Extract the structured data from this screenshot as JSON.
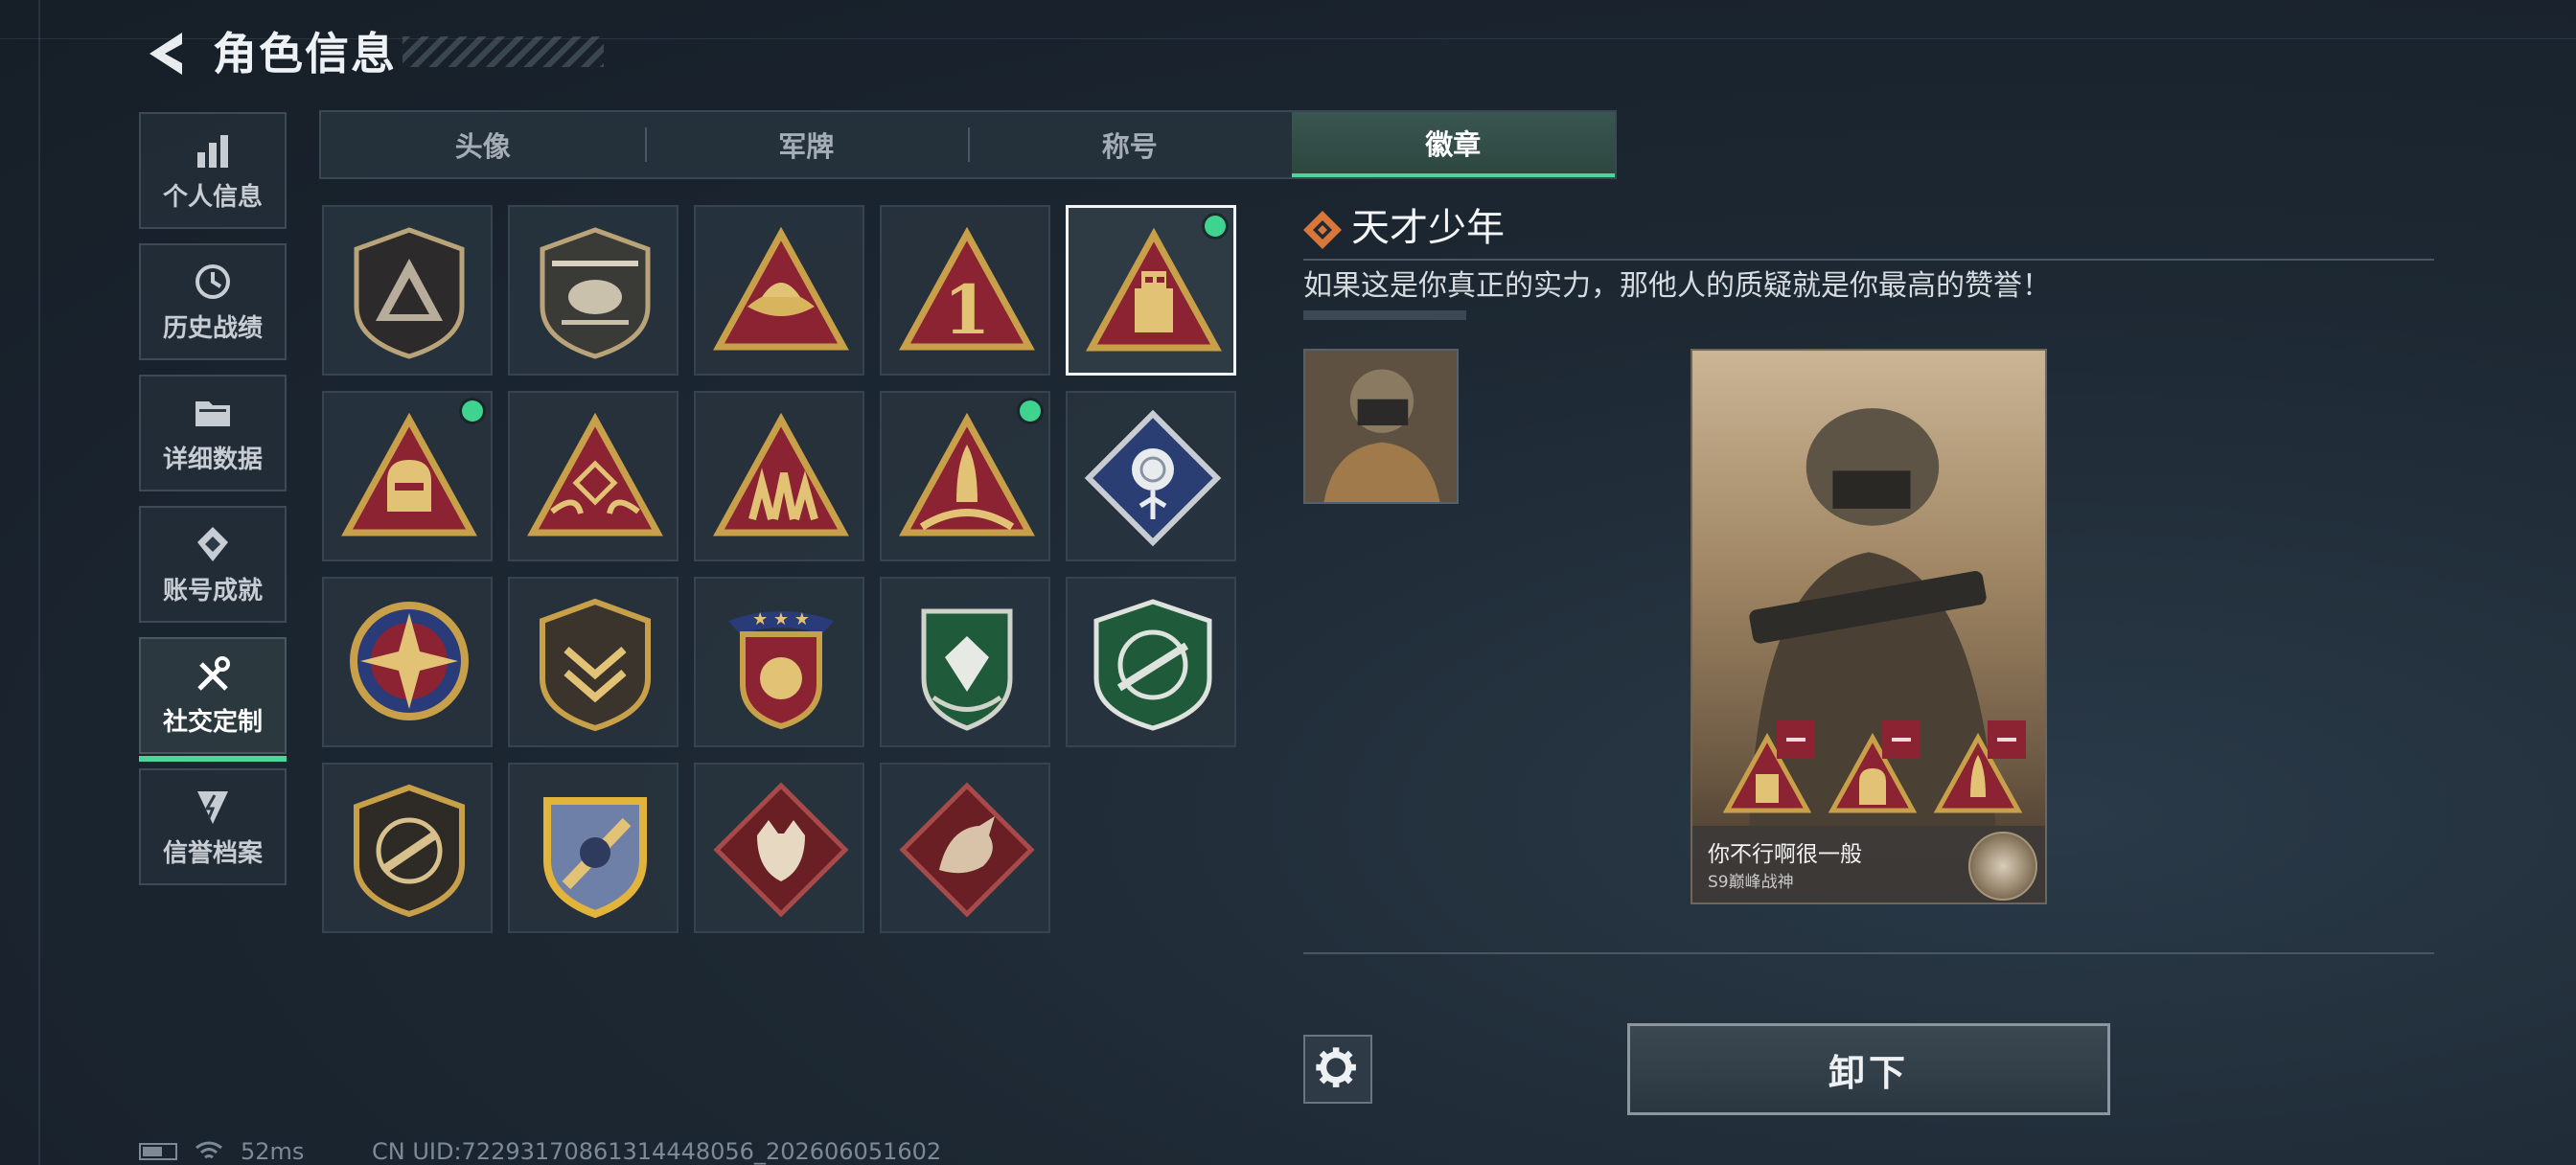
{
  "header": {
    "title": "角色信息"
  },
  "sidebar": {
    "items": [
      {
        "label": "个人信息",
        "icon": "bar-chart-icon"
      },
      {
        "label": "历史战绩",
        "icon": "history-icon"
      },
      {
        "label": "详细数据",
        "icon": "folder-icon"
      },
      {
        "label": "账号成就",
        "icon": "achievement-icon"
      },
      {
        "label": "社交定制",
        "icon": "tools-icon",
        "active": true
      },
      {
        "label": "信誉档案",
        "icon": "shield-bolt-icon"
      }
    ]
  },
  "tabs": [
    {
      "label": "头像"
    },
    {
      "label": "军牌"
    },
    {
      "label": "称号"
    },
    {
      "label": "徽章",
      "active": true
    }
  ],
  "badges": [
    {
      "icon": "mountain-shield-badge-icon"
    },
    {
      "icon": "helicopter-badge-icon"
    },
    {
      "icon": "wings-triangle-badge-icon"
    },
    {
      "icon": "number-one-triangle-badge-icon"
    },
    {
      "icon": "chess-rook-triangle-badge-icon",
      "selected": true,
      "equipped": true
    },
    {
      "icon": "helmet-triangle-badge-icon",
      "equipped": true
    },
    {
      "icon": "hands-gem-triangle-badge-icon"
    },
    {
      "icon": "soldiers-triangle-badge-icon"
    },
    {
      "icon": "rocket-triangle-badge-icon",
      "equipped": true
    },
    {
      "icon": "rose-diamond-badge-icon"
    },
    {
      "icon": "compass-star-badge-icon"
    },
    {
      "icon": "chevron-shield-badge-icon"
    },
    {
      "icon": "stars-crest-badge-icon"
    },
    {
      "icon": "gem-laurel-badge-icon"
    },
    {
      "icon": "rifle-crosshair-badge-icon"
    },
    {
      "icon": "pistol-crosshair-badge-icon"
    },
    {
      "icon": "sword-crest-badge-icon"
    },
    {
      "icon": "wolf-diamond-badge-icon"
    },
    {
      "icon": "dragon-diamond-badge-icon"
    }
  ],
  "detail": {
    "name": "天才少年",
    "description": "如果这是你真正的实力，那他人的质疑就是你最高的赞誉！"
  },
  "card": {
    "player_name": "你不行啊很一般",
    "subtitle": "S9巅峰战神"
  },
  "actions": {
    "unequip_label": "卸下"
  },
  "status": {
    "ping": "52ms",
    "uid": "CN UID:7229317086131444805​6_202606051602"
  },
  "colors": {
    "accent": "#4cd69a",
    "dot": "#3ed38e",
    "badge_red": "#8b2332",
    "gold": "#c9a04a"
  }
}
